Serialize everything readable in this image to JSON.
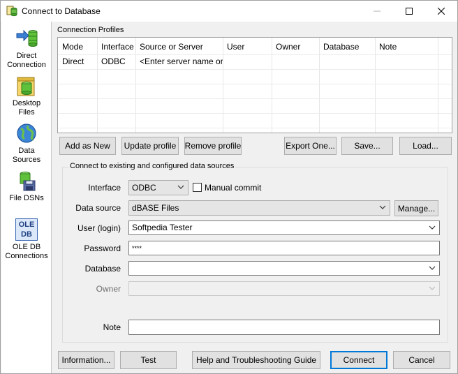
{
  "window": {
    "title": "Connect to Database"
  },
  "sidebar": {
    "items": [
      {
        "label_line1": "Direct",
        "label_line2": "Connection"
      },
      {
        "label_line1": "Desktop",
        "label_line2": "Files"
      },
      {
        "label_line1": "Data",
        "label_line2": "Sources"
      },
      {
        "label_line1": "File DSNs",
        "label_line2": ""
      },
      {
        "label_line1": "OLE DB",
        "label_line2": "Connections"
      }
    ],
    "ole_icon_text_1": "OLE",
    "ole_icon_text_2": "DB"
  },
  "profiles": {
    "group_label": "Connection Profiles",
    "columns": [
      "Mode",
      "Interface",
      "Source or Server",
      "User",
      "Owner",
      "Database",
      "Note"
    ],
    "rows": [
      [
        "Direct",
        "ODBC",
        "<Enter server name or...",
        "",
        "",
        "",
        ""
      ]
    ],
    "buttons": {
      "add_new": "Add as New",
      "update": "Update profile",
      "remove": "Remove profile",
      "export": "Export One...",
      "save": "Save...",
      "load": "Load..."
    }
  },
  "connect": {
    "group_label": "Connect to existing and configured data sources",
    "interface_label": "Interface",
    "interface_value": "ODBC",
    "manual_commit_label": "Manual commit",
    "manual_commit_checked": false,
    "data_source_label": "Data source",
    "data_source_value": "dBASE Files",
    "manage_button": "Manage...",
    "user_label": "User (login)",
    "user_value": "Softpedia Tester",
    "password_label": "Password",
    "password_value": "****",
    "database_label": "Database",
    "database_value": "",
    "owner_label": "Owner",
    "owner_value": "",
    "note_label": "Note",
    "note_value": ""
  },
  "footer": {
    "information": "Information...",
    "test": "Test",
    "help": "Help and Troubleshooting Guide",
    "connect": "Connect",
    "cancel": "Cancel"
  }
}
